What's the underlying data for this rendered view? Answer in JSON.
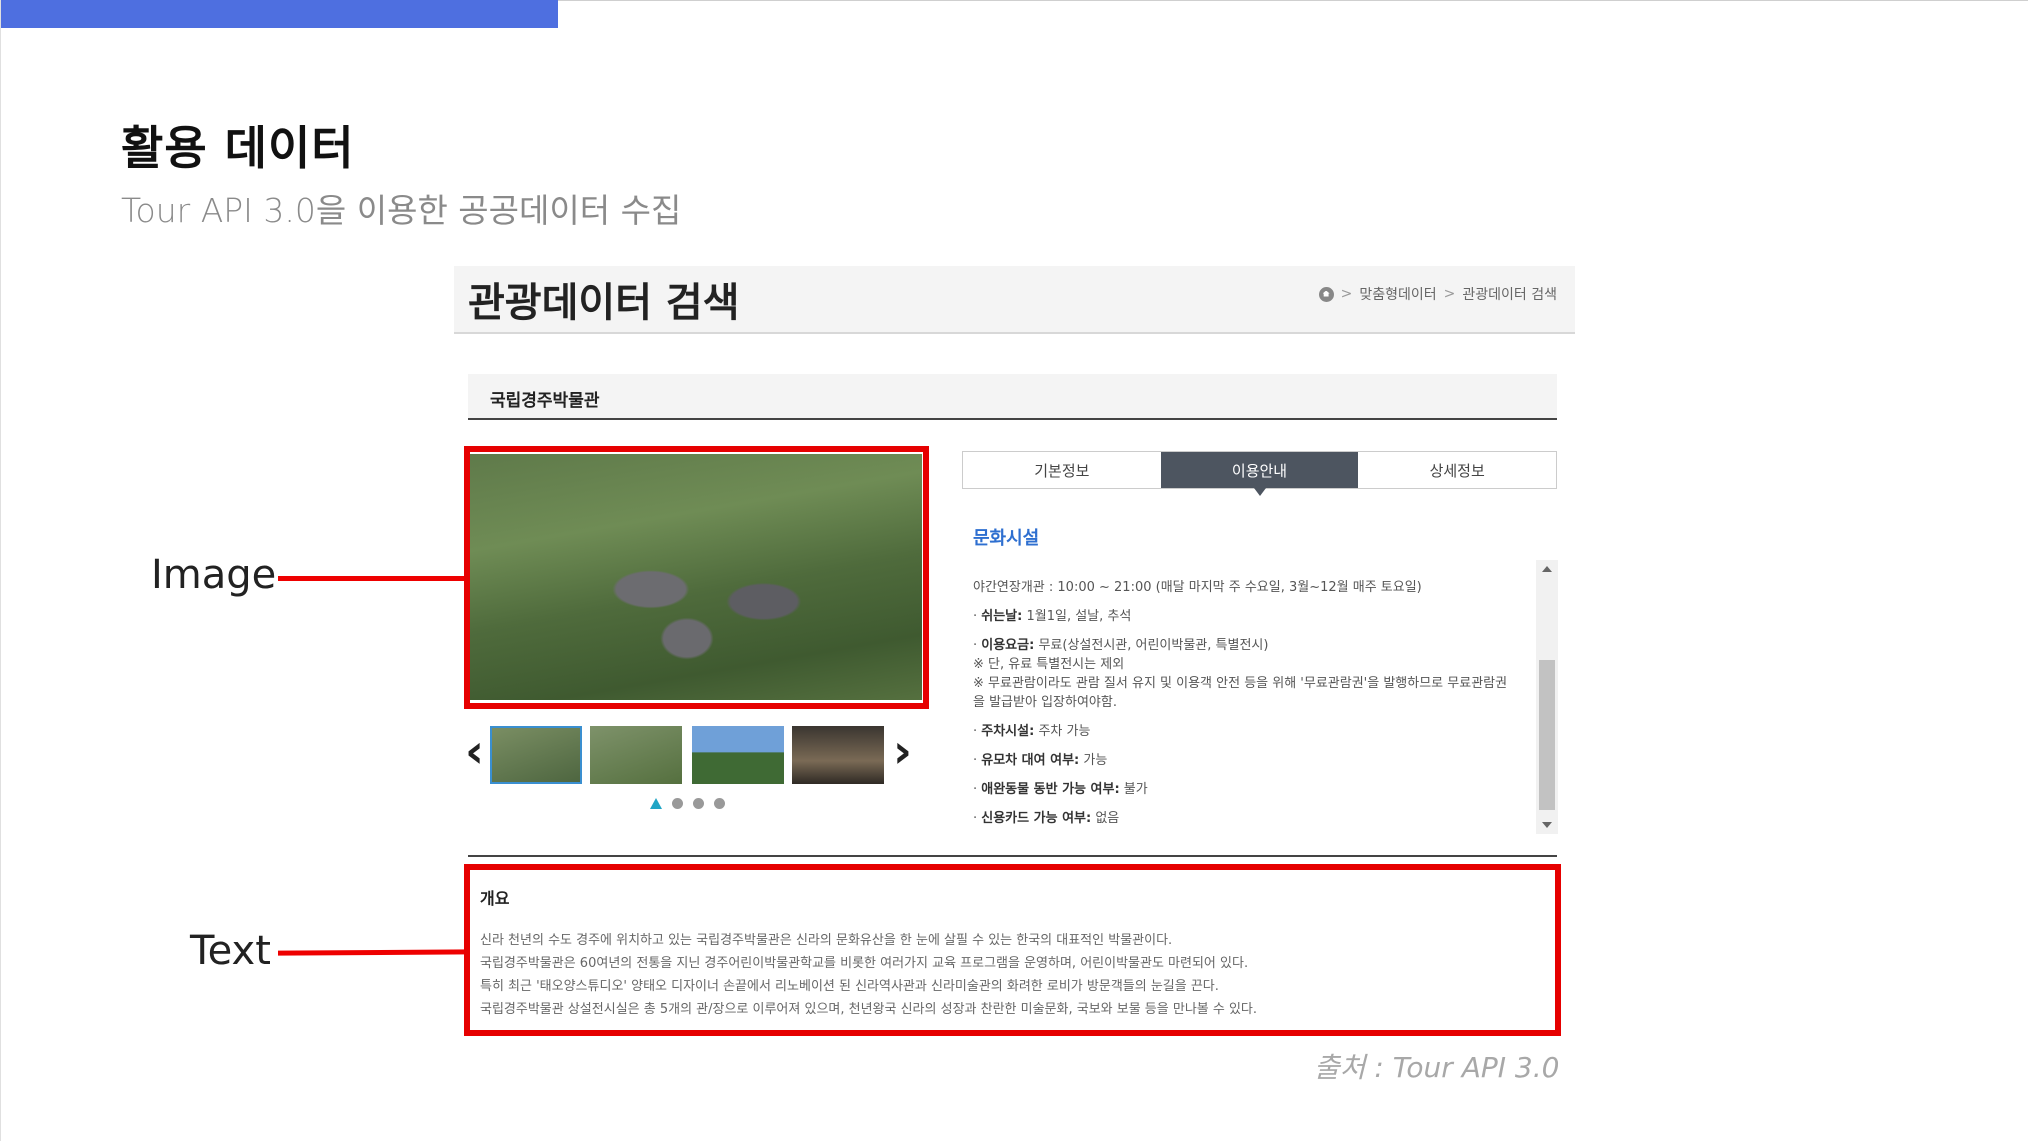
{
  "slide": {
    "title": "활용 데이터",
    "subtitle": "Tour API 3.0을 이용한 공공데이터 수집",
    "label_image": "Image",
    "label_text": "Text",
    "source": "출처 : Tour API 3.0",
    "accent_color": "#4e6fe0",
    "highlight_color": "#e60000"
  },
  "page": {
    "title": "관광데이터 검색",
    "breadcrumb": [
      "맞춤형데이터",
      "관광데이터 검색"
    ],
    "item_name": "국립경주박물관",
    "tabs": [
      {
        "label": "기본정보",
        "active": false
      },
      {
        "label": "이용안내",
        "active": true
      },
      {
        "label": "상세정보",
        "active": false
      }
    ],
    "section_heading": "문화시설",
    "info": {
      "hours": "야간연장개관 : 10:00 ~ 21:00 (매달 마지막 주 수요일, 3월~12월 매주 토요일)",
      "closed_label": "쉬는날:",
      "closed_value": "1월1일, 설날, 추석",
      "fee_label": "이용요금:",
      "fee_value": "무료(상설전시관, 어린이박물관, 특별전시)",
      "fee_note1": "※ 단, 유료 특별전시는 제외",
      "fee_note2": "※ 무료관람이라도 관람 질서 유지 및 이용객 안전 등을 위해 '무료관람권'을 발행하므로 무료관람권을 발급받아 입장하여야함.",
      "parking_label": "주차시설:",
      "parking_value": "주차 가능",
      "stroller_label": "유모차 대여 여부:",
      "stroller_value": "가능",
      "pet_label": "애완동물 동반 가능 여부:",
      "pet_value": "불가",
      "card_label": "신용카드 가능 여부:",
      "card_value": "없음"
    },
    "overview": {
      "title": "개요",
      "lines": [
        "신라 천년의 수도 경주에 위치하고 있는 국립경주박물관은 신라의 문화유산을 한 눈에 살필 수 있는 한국의 대표적인 박물관이다.",
        "국립경주박물관은 60여년의 전통을 지닌 경주어린이박물관학교를 비롯한 여러가지 교육 프로그램을 운영하며, 어린이박물관도 마련되어 있다.",
        "특히 최근 '태오양스튜디오' 양태오 디자이너 손끝에서 리노베이션 된 신라역사관과 신라미술관의 화려한 로비가 방문객들의 눈길을 끈다.",
        "국립경주박물관 상설전시실은 총 5개의 관/장으로 이루어져 있으며, 천년왕국 신라의 성장과 찬란한 미술문화, 국보와 보물 등을 만나볼 수 있다."
      ]
    },
    "icons": {
      "home": "home-icon",
      "prev": "chevron-left-icon",
      "next": "chevron-right-icon"
    }
  }
}
